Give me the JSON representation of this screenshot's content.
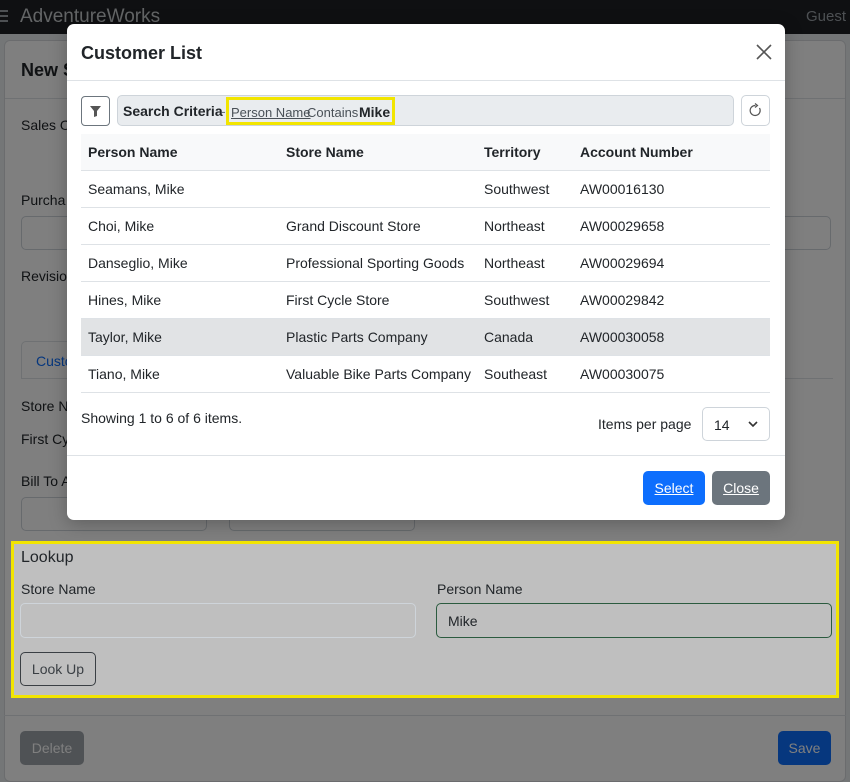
{
  "app": {
    "brand": "AdventureWorks",
    "user": "Guest"
  },
  "page": {
    "title": "New S",
    "labels": {
      "sales_order": "Sales O",
      "purchase": "Purcha",
      "revision": "Revision",
      "tab_customer": "Custo",
      "store_name": "Store N",
      "store_value": "First Cy",
      "bill_to": "Bill To A"
    },
    "lookup": {
      "title": "Lookup",
      "store_label": "Store Name",
      "store_value": "",
      "person_label": "Person Name",
      "person_value": "Mike",
      "button": "Look Up"
    },
    "footer": {
      "delete_label": "Delete",
      "save_label": "Save"
    }
  },
  "modal": {
    "title": "Customer List",
    "criteria": {
      "label": "Search Criteria",
      "separator": "-",
      "field": "Person Name",
      "operator": "Contains",
      "value": "Mike"
    },
    "table": {
      "headers": [
        "Person Name",
        "Store Name",
        "Territory",
        "Account Number"
      ],
      "rows": [
        [
          "Seamans, Mike",
          "",
          "Southwest",
          "AW00016130"
        ],
        [
          "Choi, Mike",
          "Grand Discount Store",
          "Northeast",
          "AW00029658"
        ],
        [
          "Danseglio, Mike",
          "Professional Sporting Goods",
          "Northeast",
          "AW00029694"
        ],
        [
          "Hines, Mike",
          "First Cycle Store",
          "Southwest",
          "AW00029842"
        ],
        [
          "Taylor, Mike",
          "Plastic Parts Company",
          "Canada",
          "AW00030058"
        ],
        [
          "Tiano, Mike",
          "Valuable Bike Parts Company",
          "Southeast",
          "AW00030075"
        ]
      ],
      "selected_row": 4
    },
    "showing": "Showing 1 to 6 of 6 items.",
    "items_per_page_label": "Items per page",
    "items_per_page": "14",
    "select_label": "Select",
    "close_label": "Close"
  },
  "colors": {
    "primary": "#0d6efd",
    "secondary": "#6c757d",
    "highlight": "#f2e500",
    "success_border": "#2e7d4f"
  },
  "icons": {
    "filter": "filter-icon",
    "refresh": "refresh-icon",
    "close": "close-icon",
    "menu": "menu-icon",
    "chevron": "chevron-down-icon"
  }
}
